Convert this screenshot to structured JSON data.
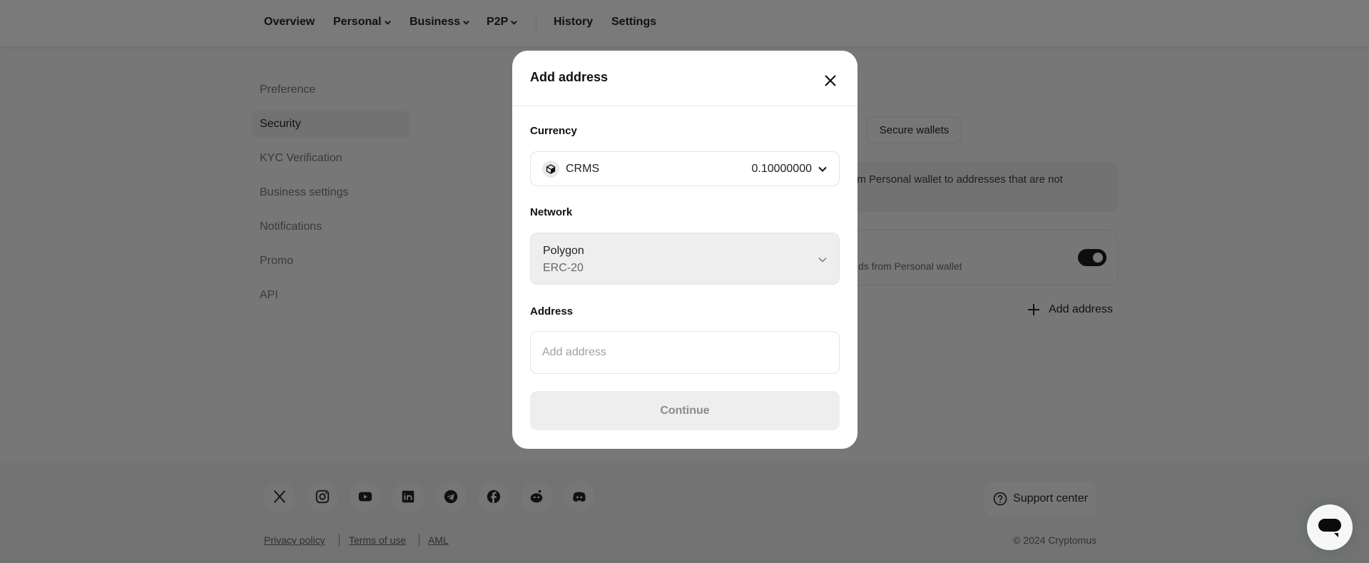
{
  "nav": {
    "items": [
      {
        "label": "Overview",
        "dropdown": false
      },
      {
        "label": "Personal",
        "dropdown": true
      },
      {
        "label": "Business",
        "dropdown": true
      },
      {
        "label": "P2P",
        "dropdown": true
      },
      {
        "label": "History",
        "dropdown": false
      },
      {
        "label": "Settings",
        "dropdown": false
      }
    ]
  },
  "sidebar": {
    "items": [
      {
        "label": "Preference"
      },
      {
        "label": "Security",
        "active": true
      },
      {
        "label": "KYC Verification"
      },
      {
        "label": "Business settings"
      },
      {
        "label": "Notifications"
      },
      {
        "label": "Promo"
      },
      {
        "label": "API"
      }
    ]
  },
  "background": {
    "tab_secure_wallets": "Secure wallets",
    "info_text": "om Personal wallet to addresses that are not",
    "toggle_subtitle": "ds from Personal wallet",
    "toggle_on": true,
    "add_address_label": "Add address"
  },
  "modal": {
    "title": "Add address",
    "currency_label": "Currency",
    "currency": {
      "name": "CRMS",
      "amount": "0.10000000",
      "icon": "cube-icon"
    },
    "network_label": "Network",
    "network": {
      "name": "Polygon",
      "standard": "ERC-20"
    },
    "address_label": "Address",
    "address_value": "",
    "address_placeholder": "Add address",
    "continue_label": "Continue"
  },
  "footer": {
    "social": [
      "x-icon",
      "instagram-icon",
      "youtube-icon",
      "linkedin-icon",
      "telegram-icon",
      "facebook-icon",
      "reddit-icon",
      "discord-icon"
    ],
    "links": [
      "Privacy policy",
      "Terms of use",
      "AML"
    ],
    "support_label": "Support center",
    "copyright": "© 2024 Cryptomus"
  },
  "colors": {
    "overlay": "#777777",
    "modal_bg": "#ffffff",
    "disabled_button": "#eeeeee"
  }
}
